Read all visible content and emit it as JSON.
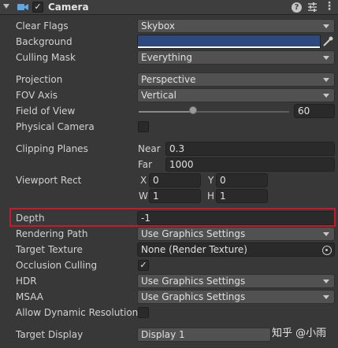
{
  "header": {
    "title": "Camera",
    "enabled_check": "✓",
    "help": "?",
    "menu": "⋮"
  },
  "rows": {
    "clear_flags": {
      "label": "Clear Flags",
      "value": "Skybox"
    },
    "background": {
      "label": "Background",
      "color": "#2c4a80"
    },
    "culling_mask": {
      "label": "Culling Mask",
      "value": "Everything"
    },
    "projection": {
      "label": "Projection",
      "value": "Perspective"
    },
    "fov_axis": {
      "label": "FOV Axis",
      "value": "Vertical"
    },
    "field_of_view": {
      "label": "Field of View",
      "value": "60",
      "slider_fraction": 0.36
    },
    "physical_camera": {
      "label": "Physical Camera",
      "checked": false
    },
    "clipping_planes": {
      "label": "Clipping Planes",
      "near_label": "Near",
      "near": "0.3",
      "far_label": "Far",
      "far": "1000"
    },
    "viewport_rect": {
      "label": "Viewport Rect",
      "x_label": "X",
      "x": "0",
      "y_label": "Y",
      "y": "0",
      "w_label": "W",
      "w": "1",
      "h_label": "H",
      "h": "1"
    },
    "depth": {
      "label": "Depth",
      "value": "-1"
    },
    "rendering_path": {
      "label": "Rendering Path",
      "value": "Use Graphics Settings"
    },
    "target_texture": {
      "label": "Target Texture",
      "value": "None (Render Texture)"
    },
    "occlusion_culling": {
      "label": "Occlusion Culling",
      "check": "✓"
    },
    "hdr": {
      "label": "HDR",
      "value": "Use Graphics Settings"
    },
    "msaa": {
      "label": "MSAA",
      "value": "Use Graphics Settings"
    },
    "allow_dynamic_resolution": {
      "label": "Allow Dynamic Resolution",
      "checked": false
    },
    "target_display": {
      "label": "Target Display",
      "value": "Display 1"
    }
  },
  "watermark": {
    "text": "知乎 @小雨"
  },
  "colors": {
    "highlight": "#c8182b",
    "panel": "#383838",
    "field": "#2a2a2a"
  },
  "icons": [
    "foldout-arrow-icon",
    "camera-icon",
    "help-icon",
    "preset-icon",
    "kebab-menu-icon",
    "color-picker-icon",
    "object-picker-icon"
  ]
}
